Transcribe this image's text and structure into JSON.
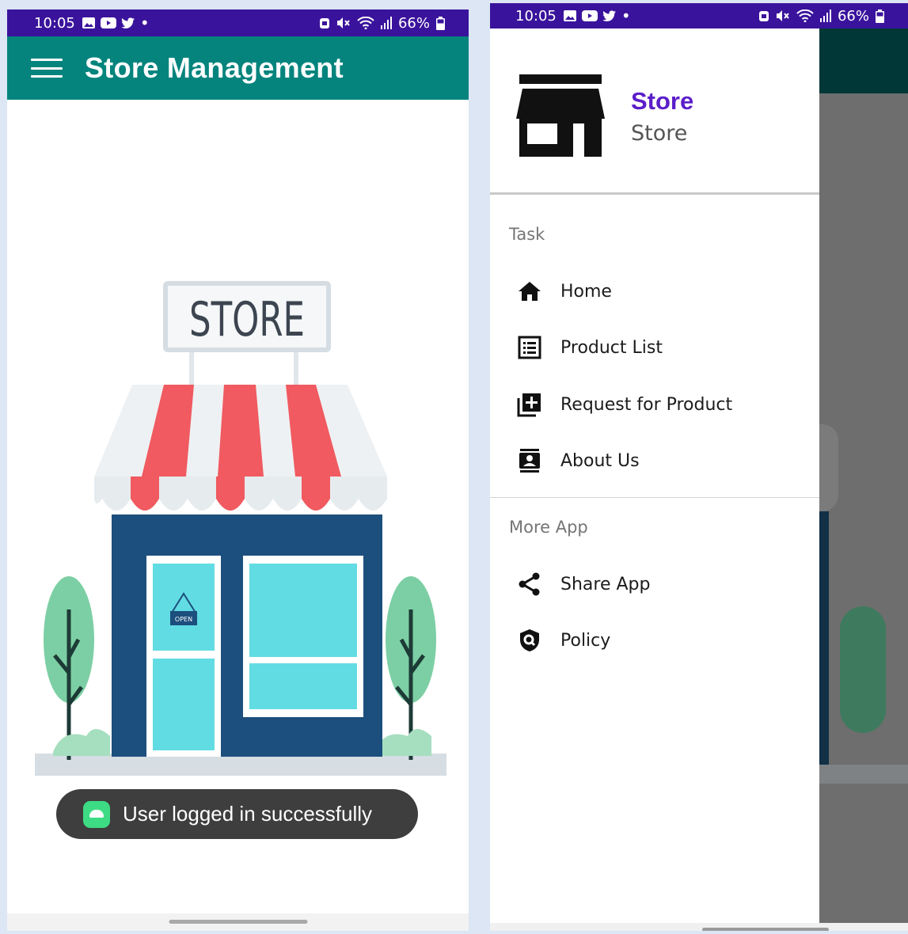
{
  "left_screen": {
    "status": {
      "time": "10:05",
      "battery": "66%"
    },
    "app_bar": {
      "title": "Store Management",
      "menu_icon": "hamburger-icon"
    },
    "illustration": {
      "sign_text": "STORE",
      "door_sign": "OPEN"
    },
    "toast": {
      "message": "User logged in successfully",
      "icon": "android-icon"
    }
  },
  "right_screen": {
    "status": {
      "time": "10:05",
      "battery": "66%"
    },
    "drawer": {
      "header": {
        "title": "Store",
        "subtitle": "Store",
        "logo_icon": "store-icon"
      },
      "sections": [
        {
          "label": "Task",
          "items": [
            {
              "label": "Home",
              "icon": "home-icon"
            },
            {
              "label": "Product List",
              "icon": "list-icon"
            },
            {
              "label": "Request for Product",
              "icon": "add-box-icon"
            },
            {
              "label": "About Us",
              "icon": "contact-icon"
            }
          ]
        },
        {
          "label": "More App",
          "items": [
            {
              "label": "Share App",
              "icon": "share-icon"
            },
            {
              "label": "Policy",
              "icon": "policy-icon"
            }
          ]
        }
      ]
    }
  },
  "colors": {
    "status_bar": "#3a139c",
    "app_bar": "#04847d",
    "drawer_title": "#5b1ec9",
    "toast_bg": "#3e3e3e"
  }
}
